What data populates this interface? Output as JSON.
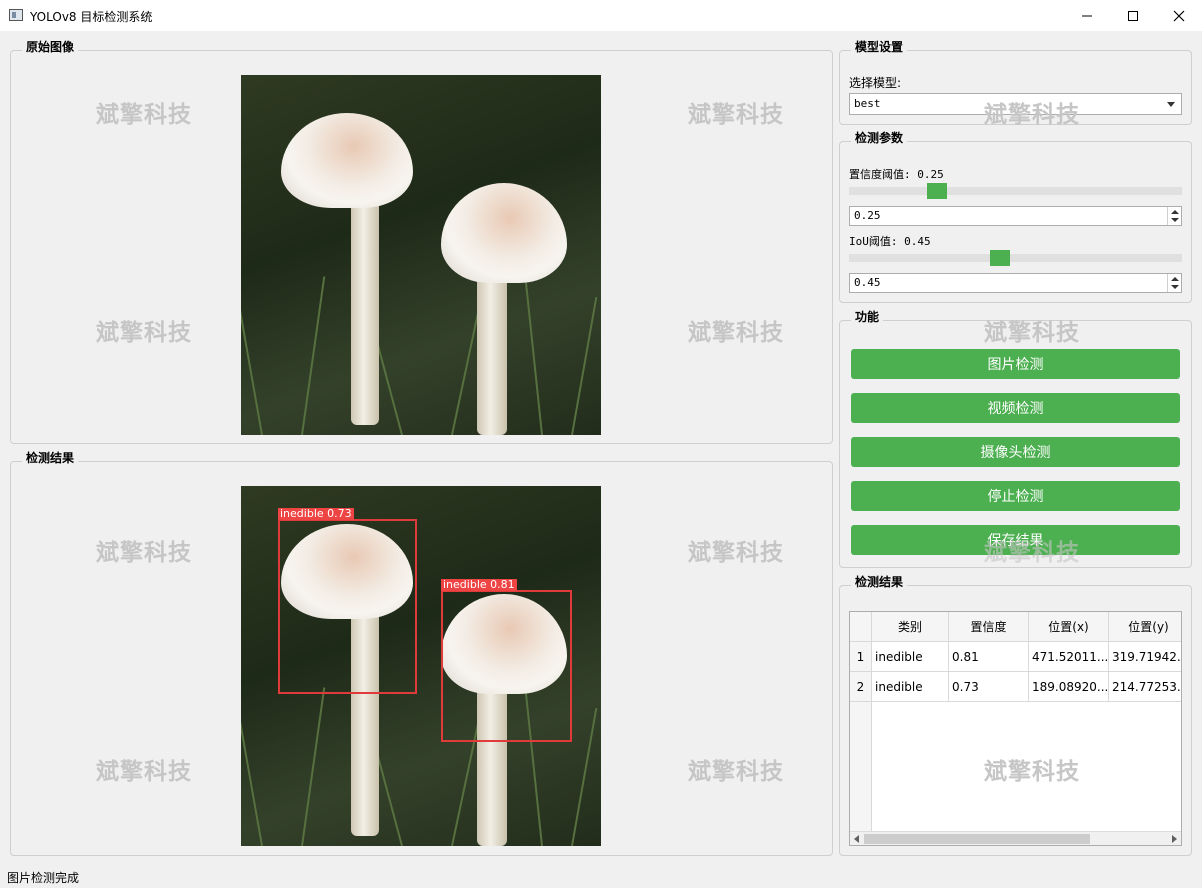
{
  "window": {
    "title": "YOLOv8 目标检测系统"
  },
  "panels": {
    "original": {
      "title": "原始图像"
    },
    "result": {
      "title": "检测结果"
    }
  },
  "watermark": "斌擎科技",
  "detections_overlay": [
    {
      "label": "inedible 0.73"
    },
    {
      "label": "inedible 0.81"
    }
  ],
  "model_settings": {
    "title": "模型设置",
    "select_label": "选择模型:",
    "selected_model": "best"
  },
  "detection_params": {
    "title": "检测参数",
    "conf_label": "置信度阈值: 0.25",
    "conf_value": "0.25",
    "conf_fraction": 0.25,
    "iou_label": "IoU阈值: 0.45",
    "iou_value": "0.45",
    "iou_fraction": 0.45
  },
  "functions": {
    "title": "功能",
    "buttons": [
      "图片检测",
      "视频检测",
      "摄像头检测",
      "停止检测",
      "保存结果"
    ],
    "accent": "#4caf50"
  },
  "results_table": {
    "title": "检测结果",
    "headers": [
      "类别",
      "置信度",
      "位置(x)",
      "位置(y)"
    ],
    "rows": [
      {
        "index": "1",
        "cls": "inedible",
        "conf": "0.81",
        "x": "471.52011...",
        "y": "319.71942..."
      },
      {
        "index": "2",
        "cls": "inedible",
        "conf": "0.73",
        "x": "189.08920...",
        "y": "214.77253..."
      }
    ]
  },
  "status_bar": {
    "text": "图片检测完成"
  }
}
